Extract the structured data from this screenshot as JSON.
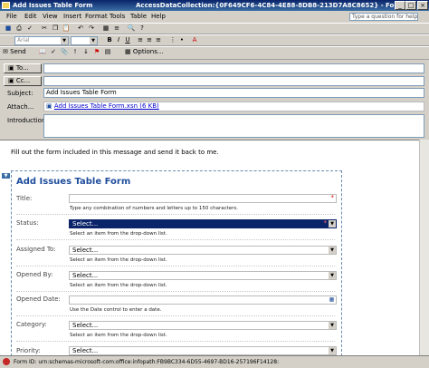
{
  "window": {
    "title": "Add Issues Table Form",
    "subtitle": "AccessDataCollection:{0F649CF6-4C84-4E88-8DB8-213D7A8C8652} - Form"
  },
  "menu": {
    "items": [
      "File",
      "Edit",
      "View",
      "Insert",
      "Format",
      "Tools",
      "Table",
      "Help"
    ],
    "help_placeholder": "Type a question for help"
  },
  "toolbar2": {
    "font": "Arial"
  },
  "toolbar3": {
    "send": "Send",
    "options": "Options..."
  },
  "header": {
    "to_label": "To...",
    "cc_label": "Cc...",
    "subject_label": "Subject:",
    "subject_value": "Add Issues Table Form",
    "attach_label": "Attach...",
    "attach_value": "Add Issues Table Form.xsn (6 KB)",
    "intro_label": "Introduction:"
  },
  "body": {
    "intro_text": "Fill out the form included in this message and send it back to me.",
    "form_title": "Add Issues Table Form",
    "fields": [
      {
        "label": "Title:",
        "value": "",
        "hint": "Type any combination of numbers and letters up to 150 characters."
      },
      {
        "label": "Status:",
        "value": "Select...",
        "hint": "Select an item from the drop-down list."
      },
      {
        "label": "Assigned To:",
        "value": "Select...",
        "hint": "Select an item from the drop-down list."
      },
      {
        "label": "Opened By:",
        "value": "Select...",
        "hint": "Select an item from the drop-down list."
      },
      {
        "label": "Opened Date:",
        "value": "",
        "hint": "Use the Date control to enter a date."
      },
      {
        "label": "Category:",
        "value": "Select...",
        "hint": "Select an item from the drop-down list."
      },
      {
        "label": "Priority:",
        "value": "Select...",
        "hint": ""
      }
    ],
    "required_mark": "*"
  },
  "status": {
    "text": "Form ID: urn:schemas-microsoft-com:office:infopath:FB9BC334-6D55-4697-BD16-257196F14128:"
  }
}
